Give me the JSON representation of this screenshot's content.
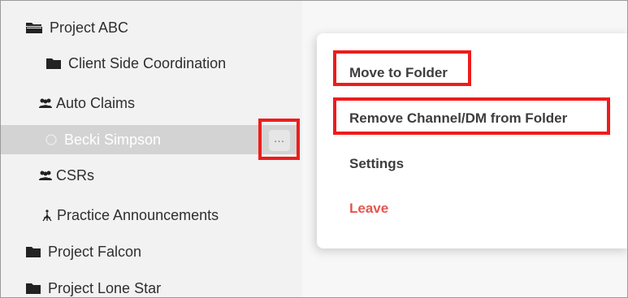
{
  "sidebar": {
    "items": [
      {
        "label": "Project ABC",
        "icon": "folder-open-icon"
      },
      {
        "label": "Client Side Coordination",
        "icon": "folder-icon"
      },
      {
        "label": "Auto Claims",
        "icon": "group-icon"
      },
      {
        "label": "Becki Simpson",
        "icon": "status-circle-icon",
        "selected": true
      },
      {
        "label": "CSRs",
        "icon": "group-icon"
      },
      {
        "label": "Practice Announcements",
        "icon": "broadcast-icon"
      },
      {
        "label": "Project Falcon",
        "icon": "folder-icon"
      },
      {
        "label": "Project Lone Star",
        "icon": "folder-icon"
      }
    ],
    "more_button_label": "…"
  },
  "context_menu": {
    "items": [
      {
        "label": "Move to Folder"
      },
      {
        "label": "Remove Channel/DM from Folder"
      },
      {
        "label": "Settings"
      },
      {
        "label": "Leave"
      }
    ]
  },
  "colors": {
    "highlight": "#ee1c1c",
    "danger": "#e5554f",
    "selected_row": "#d3d3d3",
    "sidebar_bg": "#f2f2f2"
  }
}
